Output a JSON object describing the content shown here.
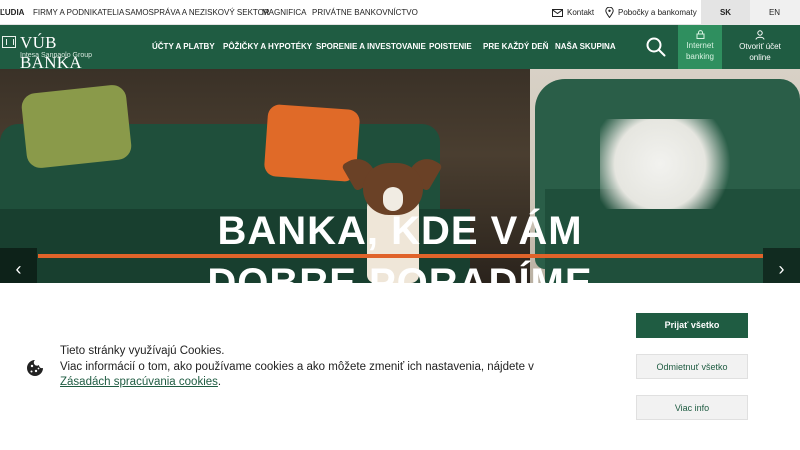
{
  "topbar": {
    "segments": [
      "ĽUDIA",
      "FIRMY A PODNIKATELIA",
      "SAMOSPRÁVA A NEZISKOVÝ SEKTOR",
      "MAGNIFICA",
      "PRIVÁTNE BANKOVNÍCTVO"
    ],
    "contact_label": "Kontakt",
    "branches_label": "Pobočky a bankomaty",
    "languages": [
      "SK",
      "EN"
    ]
  },
  "header": {
    "logo_name": "VÚB BANKA",
    "logo_subtitle": "Intesa Sanpaolo Group",
    "nav": [
      "ÚČTY A PLATBY",
      "PÔŽIČKY A HYPOTÉKY",
      "SPORENIE A INVESTOVANIE",
      "POISTENIE",
      "PRE KAŽDÝ DEŇ",
      "NAŠA SKUPINA"
    ],
    "internet_banking_line1": "Internet",
    "internet_banking_line2": "banking",
    "open_account_line1": "Otvoriť účet",
    "open_account_line2": "online"
  },
  "hero": {
    "title_line1": "BANKA, KDE VÁM",
    "title_line2": "DOBRE PORADÍME",
    "prev_icon": "‹",
    "next_icon": "›"
  },
  "cookie_banner": {
    "line1": "Tieto stránky využívajú Cookies.",
    "line2_prefix": "Viac informácií o tom, ako používame cookies a ako môžete zmeniť ich nastavenia, nájdete v ",
    "link_text": "Zásadách spracúvania cookies",
    "line2_suffix": ".",
    "accept_label": "Prijať všetko",
    "reject_label": "Odmietnuť všetko",
    "more_label": "Viac info"
  },
  "colors": {
    "brand_green": "#1f5c42",
    "accent_green": "#2f8f5f",
    "accent_orange": "#e0632a"
  },
  "icons": [
    "mail-icon",
    "location-pin-icon",
    "search-icon",
    "lock-icon",
    "person-icon",
    "cookie-icon",
    "chevron-left-icon",
    "chevron-right-icon"
  ]
}
